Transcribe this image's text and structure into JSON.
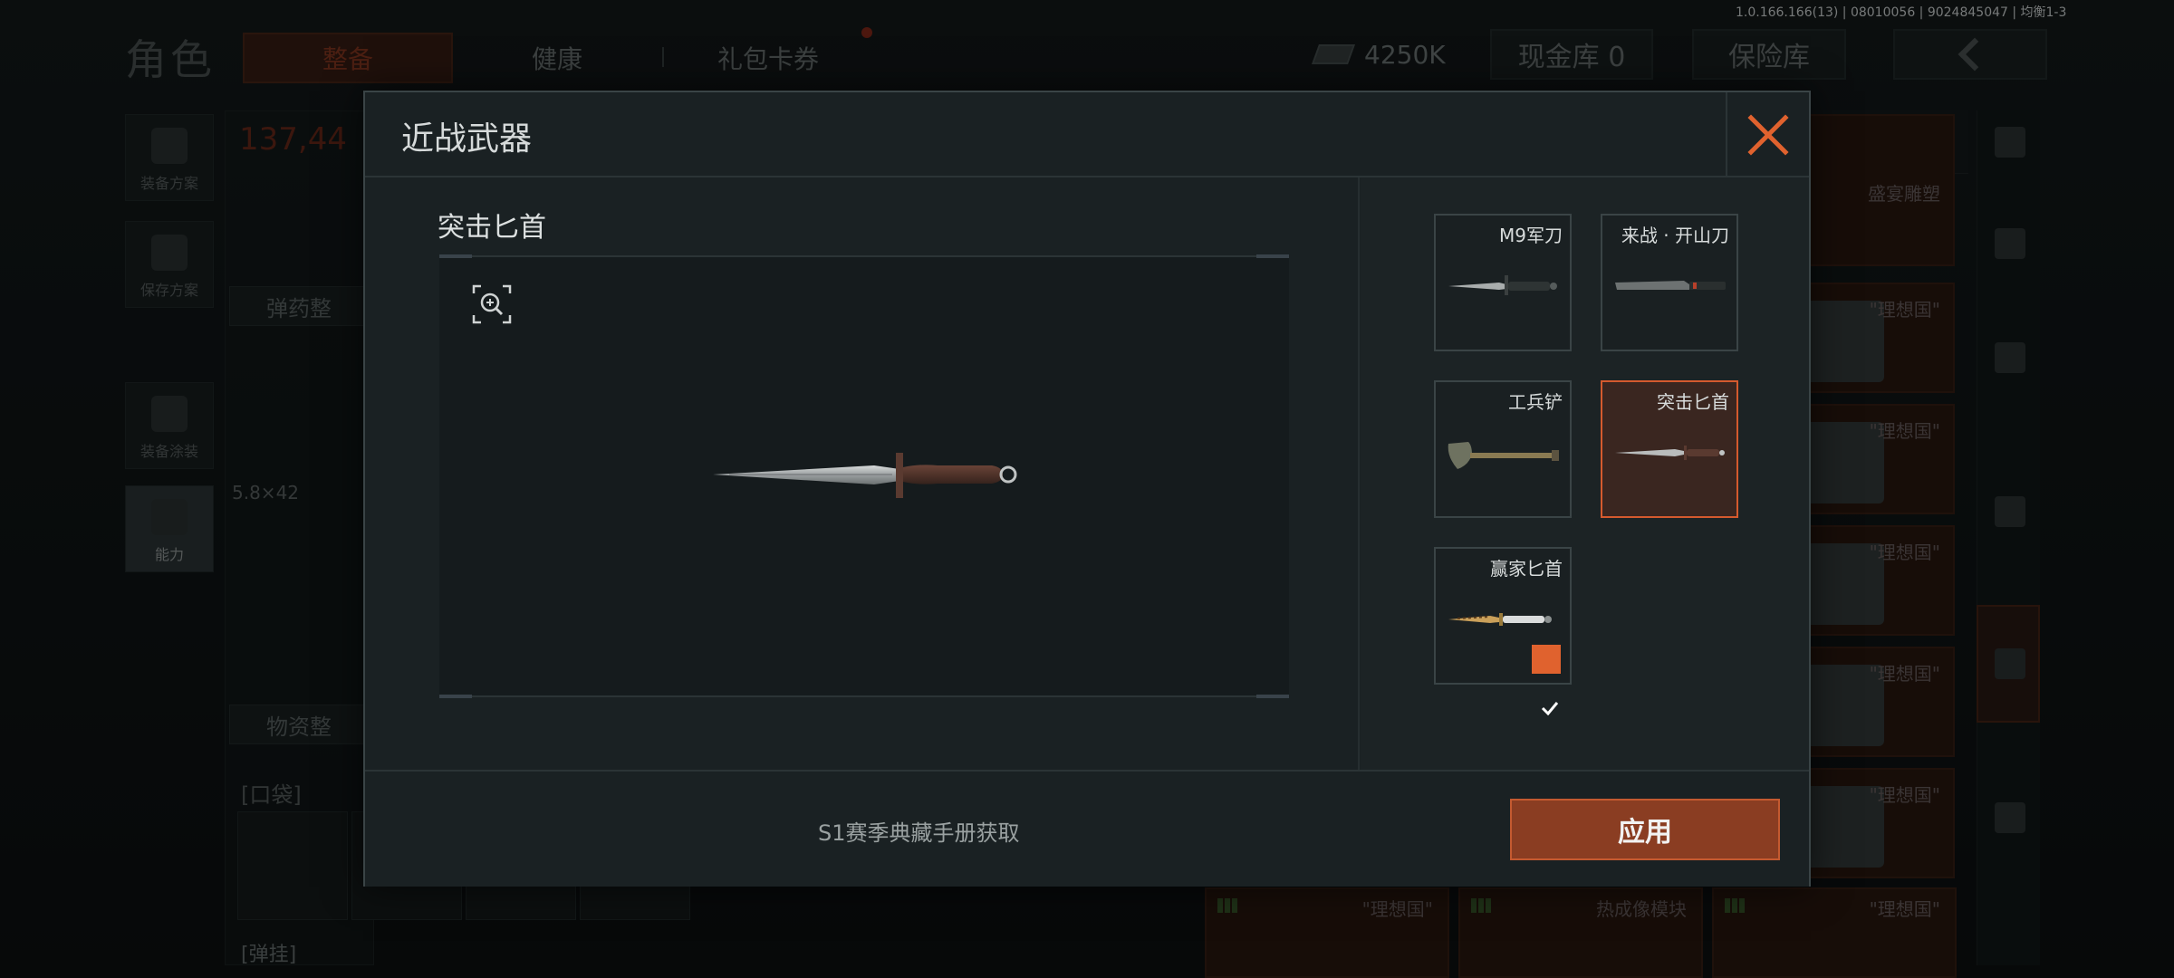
{
  "version": "1.0.166.166(13) | 08010056 | 9024845047 | 均衡1-3",
  "background": {
    "role_title": "角色",
    "tabs": {
      "equip": "整备",
      "health": "健康",
      "gift": "礼包卡券"
    },
    "money": "4250K",
    "cash_vault": "现金库 0",
    "safe": "保险库",
    "armor_value": "137,44",
    "rail": {
      "plan": "装备方案",
      "save": "保存方案",
      "paint": "装备涂装",
      "ability": "能力"
    },
    "ammo_tidy": "弹药整",
    "supply_tidy": "物资整",
    "caliber": "5.8×42",
    "pocket": "[口袋]",
    "bottom_label": "[弹挂]",
    "store": {
      "top_item": "盛宴雕塑",
      "items": [
        "\"理想国\"",
        "\"理想国\"",
        "\"理想国\"",
        "\"理想国\"",
        "\"理想国\""
      ],
      "bottom": [
        "\"理想国\"",
        "热成像模块",
        "\"理想国\""
      ]
    }
  },
  "modal": {
    "title": "近战武器",
    "item_name": "突击匕首",
    "source": "S1赛季典藏手册获取",
    "apply": "应用",
    "weapons": [
      {
        "name": "M9军刀",
        "icon": "m9-bayonet-icon"
      },
      {
        "name": "来战 · 开山刀",
        "icon": "machete-icon"
      },
      {
        "name": "工兵铲",
        "icon": "shovel-icon"
      },
      {
        "name": "突击匕首",
        "icon": "assault-dagger-icon",
        "selected": true
      },
      {
        "name": "赢家匕首",
        "icon": "winner-dagger-icon",
        "equipped": true
      }
    ]
  },
  "colors": {
    "accent": "#e0622e",
    "apply_bg": "#8a3d22",
    "selected_bg": "#3a2620"
  }
}
